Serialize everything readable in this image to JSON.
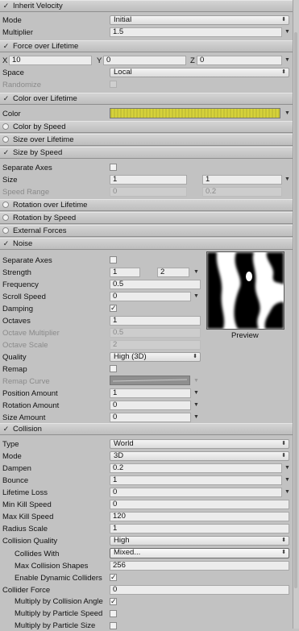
{
  "sections": {
    "inherit_velocity": "Inherit Velocity",
    "force_over_lifetime": "Force over Lifetime",
    "color_over_lifetime": "Color over Lifetime",
    "color_by_speed": "Color by Speed",
    "size_over_lifetime": "Size over Lifetime",
    "size_by_speed": "Size by Speed",
    "rotation_over_lifetime": "Rotation over Lifetime",
    "rotation_by_speed": "Rotation by Speed",
    "external_forces": "External Forces",
    "noise": "Noise",
    "collision": "Collision"
  },
  "check_glyph": "✓",
  "inherit_velocity": {
    "mode_label": "Mode",
    "mode_value": "Initial",
    "multiplier_label": "Multiplier",
    "multiplier_value": "1.5"
  },
  "force_over_lifetime": {
    "x_label": "X",
    "x_value": "10",
    "y_label": "Y",
    "y_value": "0",
    "z_label": "Z",
    "z_value": "0",
    "space_label": "Space",
    "space_value": "Local",
    "randomize_label": "Randomize"
  },
  "color_over_lifetime": {
    "color_label": "Color",
    "gradient_color": "#d6d23a"
  },
  "size_by_speed": {
    "separate_axes_label": "Separate Axes",
    "size_label": "Size",
    "size_value_1": "1",
    "size_value_2": "1",
    "speed_range_label": "Speed Range",
    "speed_range_1": "0",
    "speed_range_2": "0.2"
  },
  "noise": {
    "separate_axes_label": "Separate Axes",
    "strength_label": "Strength",
    "strength_1": "1",
    "strength_2": "2",
    "frequency_label": "Frequency",
    "frequency_value": "0.5",
    "scroll_speed_label": "Scroll Speed",
    "scroll_speed_value": "0",
    "damping_label": "Damping",
    "octaves_label": "Octaves",
    "octaves_value": "1",
    "octave_multiplier_label": "Octave Multiplier",
    "octave_multiplier_value": "0.5",
    "octave_scale_label": "Octave Scale",
    "octave_scale_value": "2",
    "quality_label": "Quality",
    "quality_value": "High (3D)",
    "remap_label": "Remap",
    "remap_curve_label": "Remap Curve",
    "position_amount_label": "Position Amount",
    "position_amount_value": "1",
    "rotation_amount_label": "Rotation Amount",
    "rotation_amount_value": "0",
    "size_amount_label": "Size Amount",
    "size_amount_value": "0",
    "preview_label": "Preview"
  },
  "collision": {
    "type_label": "Type",
    "type_value": "World",
    "mode_label": "Mode",
    "mode_value": "3D",
    "dampen_label": "Dampen",
    "dampen_value": "0.2",
    "bounce_label": "Bounce",
    "bounce_value": "1",
    "lifetime_loss_label": "Lifetime Loss",
    "lifetime_loss_value": "0",
    "min_kill_speed_label": "Min Kill Speed",
    "min_kill_speed_value": "0",
    "max_kill_speed_label": "Max Kill Speed",
    "max_kill_speed_value": "120",
    "radius_scale_label": "Radius Scale",
    "radius_scale_value": "1",
    "collision_quality_label": "Collision Quality",
    "collision_quality_value": "High",
    "collides_with_label": "Collides With",
    "collides_with_value": "Mixed...",
    "max_collision_shapes_label": "Max Collision Shapes",
    "max_collision_shapes_value": "256",
    "enable_dynamic_colliders_label": "Enable Dynamic Colliders",
    "collider_force_label": "Collider Force",
    "collider_force_value": "0",
    "multiply_collision_angle_label": "Multiply by Collision Angle",
    "multiply_particle_speed_label": "Multiply by Particle Speed",
    "multiply_particle_size_label": "Multiply by Particle Size"
  }
}
